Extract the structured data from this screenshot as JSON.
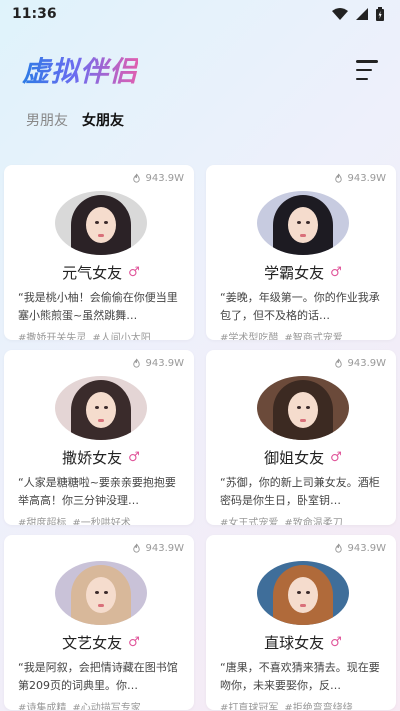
{
  "status": {
    "time": "11:36"
  },
  "header": {
    "title": "虚拟伴侣",
    "menu_icon": "menu-icon"
  },
  "tabs": [
    {
      "label": "男朋友",
      "active": false
    },
    {
      "label": "女朋友",
      "active": true
    }
  ],
  "cards": [
    {
      "views": "943.9W",
      "name": "元气女友",
      "gender": "♂",
      "desc": "“我是桃小柚！会偷偷在你便当里塞小熊煎蛋~虽然跳舞…",
      "tags": [
        "#撒娇开关失灵",
        "#人间小太阳"
      ],
      "hair": "#2b2226",
      "bg": "#d9d9d9"
    },
    {
      "views": "943.9W",
      "name": "学霸女友",
      "gender": "♂",
      "desc": "“姜晚，年级第一。你的作业我承包了，但不及格的话…",
      "tags": [
        "#学术型吃醋",
        "#智商式宠爱"
      ],
      "hair": "#1d1b22",
      "bg": "#c7cbe0"
    },
    {
      "views": "943.9W",
      "name": "撒娇女友",
      "gender": "♂",
      "desc": "“人家是糖糖啦~要亲亲要抱抱要举高高！你三分钟没理…",
      "tags": [
        "#甜度超标",
        "#一秒哄好术"
      ],
      "hair": "#3a2b2b",
      "bg": "#e4d5d5"
    },
    {
      "views": "943.9W",
      "name": "御姐女友",
      "gender": "♂",
      "desc": "“苏御，你的新上司兼女友。酒柜密码是你生日，卧室钥…",
      "tags": [
        "#女王式宠爱",
        "#致命温柔刀"
      ],
      "hair": "#3c2a22",
      "bg": "#6b4a3a"
    },
    {
      "views": "943.9W",
      "name": "文艺女友",
      "gender": "♂",
      "desc": "“我是阿叙，会把情诗藏在图书馆第209页的词典里。你…",
      "tags": [
        "#诗集成精",
        "#心动描写专家"
      ],
      "hair": "#d8b89a",
      "bg": "#c9c2d8"
    },
    {
      "views": "943.9W",
      "name": "直球女友",
      "gender": "♂",
      "desc": "“唐果，不喜欢猜来猜去。现在要吻你，未来要娶你，反…",
      "tags": [
        "#打直球冠军",
        "#拒绝弯弯绕绕"
      ],
      "hair": "#b06a3a",
      "bg": "#3f6e9a"
    }
  ]
}
